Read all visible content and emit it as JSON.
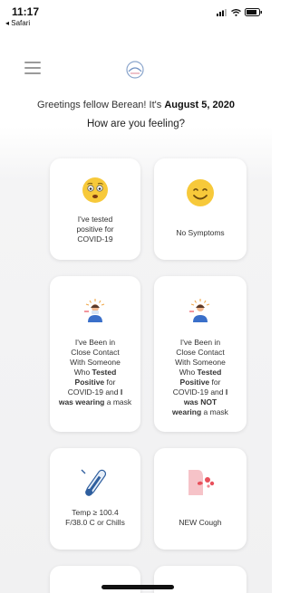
{
  "status_bar": {
    "time": "11:17",
    "back_label": "◂ Safari"
  },
  "greeting": {
    "prefix": "Greetings fellow Berean! It's ",
    "date": "August 5, 2020"
  },
  "question": "How are you feeling?",
  "cards": [
    {
      "label": "I've tested positive for COVID-19",
      "icon": "worried-face-icon"
    },
    {
      "label": "No Symptoms",
      "icon": "smiling-face-icon"
    },
    {
      "lines": [
        "I've Been in",
        "Close Contact",
        "With Someone",
        "Who ",
        "Tested",
        "Positive",
        " for",
        "COVID-19 and ",
        "I",
        "was wearing",
        " a mask"
      ],
      "icon": "person-alert-icon"
    },
    {
      "lines": [
        "I've Been in",
        "Close Contact",
        "With Someone",
        "Who ",
        "Tested",
        "Positive",
        " for",
        "COVID-19 and ",
        "I",
        "was NOT",
        "wearing",
        " a mask"
      ],
      "icon": "person-alert-icon"
    },
    {
      "label": "Temp ≥ 100.4 F/38.0 C or Chills",
      "icon": "thermometer-icon"
    },
    {
      "label": "NEW Cough",
      "icon": "cough-icon"
    }
  ],
  "colors": {
    "accent": "#f7c93a",
    "red": "#e8505b",
    "blue": "#3a6fc9"
  }
}
